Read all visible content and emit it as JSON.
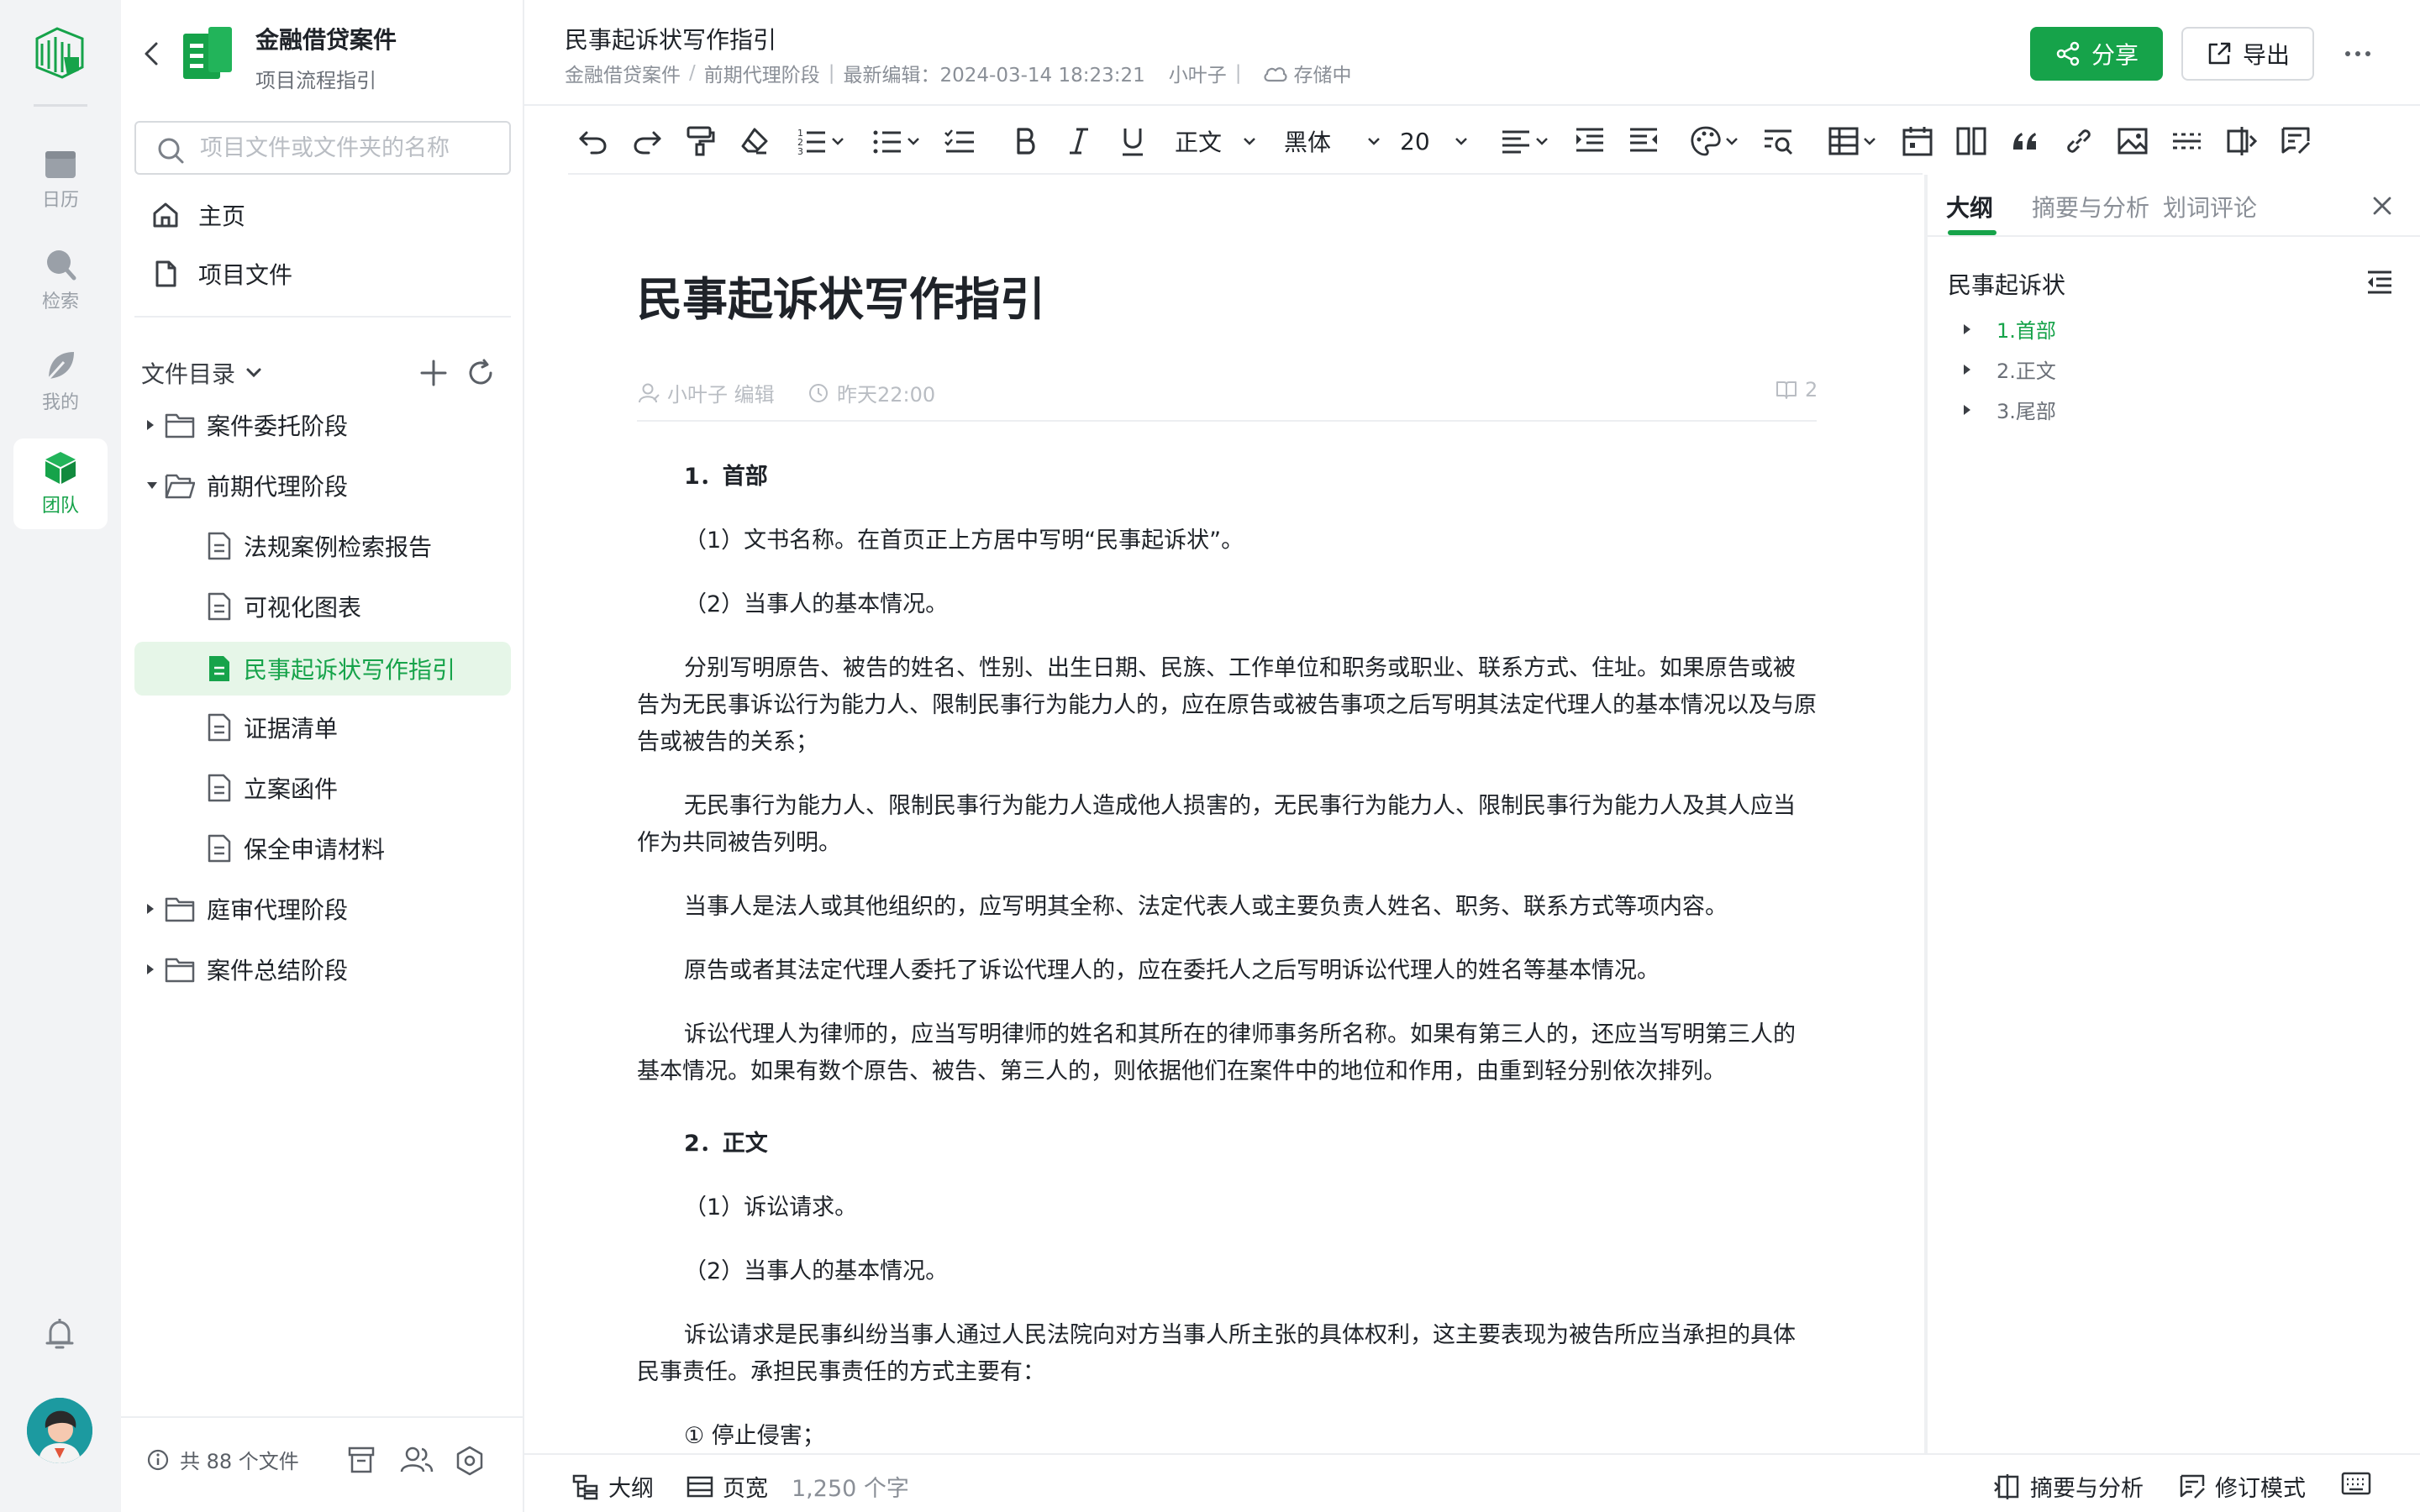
{
  "rail": {
    "items": [
      {
        "label": "日历",
        "icon": "calendar-icon"
      },
      {
        "label": "检索",
        "icon": "search-icon"
      },
      {
        "label": "我的",
        "icon": "leaf-icon"
      },
      {
        "label": "团队",
        "icon": "team-cube-icon"
      }
    ],
    "active": "团队"
  },
  "project": {
    "title": "金融借贷案件",
    "subtitle": "项目流程指引"
  },
  "search": {
    "placeholder": "项目文件或文件夹的名称",
    "value": ""
  },
  "nav": [
    {
      "label": "主页"
    },
    {
      "label": "项目文件"
    }
  ],
  "directory": {
    "header": "文件目录",
    "tree": [
      {
        "label": "案件委托阶段",
        "type": "folder",
        "expanded": false
      },
      {
        "label": "前期代理阶段",
        "type": "folder",
        "expanded": true
      },
      {
        "label": "法规案例检索报告",
        "type": "doc"
      },
      {
        "label": "可视化图表",
        "type": "doc"
      },
      {
        "label": "民事起诉状写作指引",
        "type": "doc",
        "active": true
      },
      {
        "label": "证据清单",
        "type": "doc"
      },
      {
        "label": "立案函件",
        "type": "doc"
      },
      {
        "label": "保全申请材料",
        "type": "doc"
      },
      {
        "label": "庭审代理阶段",
        "type": "folder",
        "expanded": false
      },
      {
        "label": "案件总结阶段",
        "type": "folder",
        "expanded": false
      }
    ],
    "footer": "共 88 个文件"
  },
  "header": {
    "doc_title": "民事起诉状写作指引",
    "breadcrumb": [
      "金融借贷案件",
      "前期代理阶段"
    ],
    "edited": "最新编辑：2024-03-14 18:23:21",
    "editor": "小叶子",
    "save_status": "存储中",
    "share_label": "分享",
    "export_label": "导出"
  },
  "toolbar": {
    "paragraph_style": "正文",
    "font": "黑体",
    "font_size": "20"
  },
  "editor": {
    "title": "民事起诉状写作指引",
    "author": "小叶子 编辑",
    "time": "昨天22:00",
    "readers": "2",
    "paragraphs": [
      {
        "text": "1．首部",
        "heading": true
      },
      {
        "text": "（1）文书名称。在首页正上方居中写明“民事起诉状”。"
      },
      {
        "text": "（2）当事人的基本情况。"
      },
      {
        "text": "分别写明原告、被告的姓名、性别、出生日期、民族、工作单位和职务或职业、联系方式、住址。如果原告或被告为无民事诉讼行为能力人、限制民事行为能力人的，应在原告或被告事项之后写明其法定代理人的基本情况以及与原告或被告的关系；"
      },
      {
        "text": "无民事行为能力人、限制民事行为能力人造成他人损害的，无民事行为能力人、限制民事行为能力人及其人应当作为共同被告列明。"
      },
      {
        "text": "当事人是法人或其他组织的，应写明其全称、法定代表人或主要负责人姓名、职务、联系方式等项内容。"
      },
      {
        "text": "原告或者其法定代理人委托了诉讼代理人的，应在委托人之后写明诉讼代理人的姓名等基本情况。"
      },
      {
        "text": "诉讼代理人为律师的，应当写明律师的姓名和其所在的律师事务所名称。如果有第三人的，还应当写明第三人的基本情况。如果有数个原告、被告、第三人的，则依据他们在案件中的地位和作用，由重到轻分别依次排列。"
      },
      {
        "text": "2．正文",
        "heading": true
      },
      {
        "text": "（1）诉讼请求。"
      },
      {
        "text": "（2）当事人的基本情况。"
      },
      {
        "text": "诉讼请求是民事纠纷当事人通过人民法院向对方当事人所主张的具体权利，这主要表现为被告所应当承担的具体民事责任。承担民事责任的方式主要有："
      },
      {
        "text": "① 停止侵害；"
      }
    ]
  },
  "panel": {
    "tabs": [
      "大纲",
      "摘要与分析",
      "划词评论"
    ],
    "active_tab": "大纲",
    "root": "民事起诉状",
    "nodes": [
      {
        "label": "1.首部",
        "active": true
      },
      {
        "label": "2.正文"
      },
      {
        "label": "3.尾部"
      }
    ]
  },
  "statusbar": {
    "outline": "大纲",
    "page_width": "页宽",
    "word_count": "1,250 个字",
    "summary": "摘要与分析",
    "revision": "修订模式"
  },
  "colors": {
    "accent": "#16a34a",
    "accent_light": "#e6f6e8",
    "rail_bg": "#f2f3f5"
  }
}
